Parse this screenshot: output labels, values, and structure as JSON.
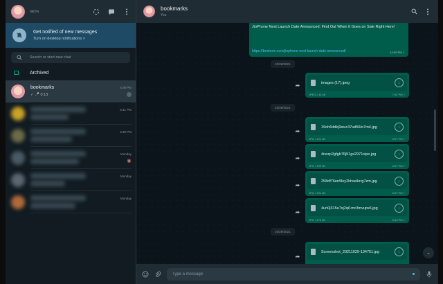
{
  "sidebar": {
    "beta_label": "BETA",
    "notification": {
      "title": "Get notified of new messages",
      "subtitle": "Turn on desktop notifications >"
    },
    "search_placeholder": "Search or start new chat",
    "archived_label": "Archived",
    "chats": [
      {
        "name": "bookmarks",
        "time": "4:06 PM",
        "preview": "✓ 🎤 0:13",
        "blurred": false
      },
      {
        "name": "",
        "time": "5:41 PM",
        "preview": "",
        "blurred": true
      },
      {
        "name": "",
        "time": "3:39 PM",
        "preview": "",
        "blurred": true
      },
      {
        "name": "",
        "time": "Monday",
        "preview": "",
        "blurred": true
      },
      {
        "name": "",
        "time": "Monday",
        "preview": "",
        "blurred": true
      },
      {
        "name": "",
        "time": "Monday",
        "preview": "",
        "blurred": true
      }
    ]
  },
  "conversation": {
    "name": "bookmarks",
    "subtitle": "You",
    "link_message": {
      "text": "JioPhone Next Launch Date Announced: Find Out When It Goes on Sale Right Here!",
      "url": "https://beebom.com/jiophone-next-launch-date-announced/",
      "time": "12:50 PM ✓"
    },
    "dates": [
      "10/26/2021",
      "10/28/2021",
      "10/29/2021"
    ],
    "files": [
      {
        "name": "images (17).jpeg",
        "size": "JPEG • 43 kB",
        "time": "7:52 PM ✓"
      },
      {
        "name": "19oh6ddkj9siuc37ud56to7m4.jpg",
        "size": "JPG • 121 kB",
        "time": "5:57 PM ✓"
      },
      {
        "name": "4nezp2gfgb76j51gs2971sipe.jpg",
        "size": "JPG • 199 kB",
        "time": "5:57 PM ✓"
      },
      {
        "name": "258df76en9ley2khseikrrg7zm.jpg",
        "size": "JPG • 131 kB",
        "time": "5:57 PM ✓"
      },
      {
        "name": "4un0j315e7xj2qi1mc3mvupx6.jpg",
        "size": "JPG • 473 kB",
        "time": "5:43 PM ✓"
      },
      {
        "name": "Screenshot_20211029-134751.jpg",
        "size": "",
        "time": ""
      }
    ],
    "composer_placeholder": "Type a message"
  },
  "colors": {
    "accent": "#00a884",
    "outgoing_bubble": "#005c4b",
    "notification_bg": "#1e4a66",
    "link": "#53bdeb"
  }
}
